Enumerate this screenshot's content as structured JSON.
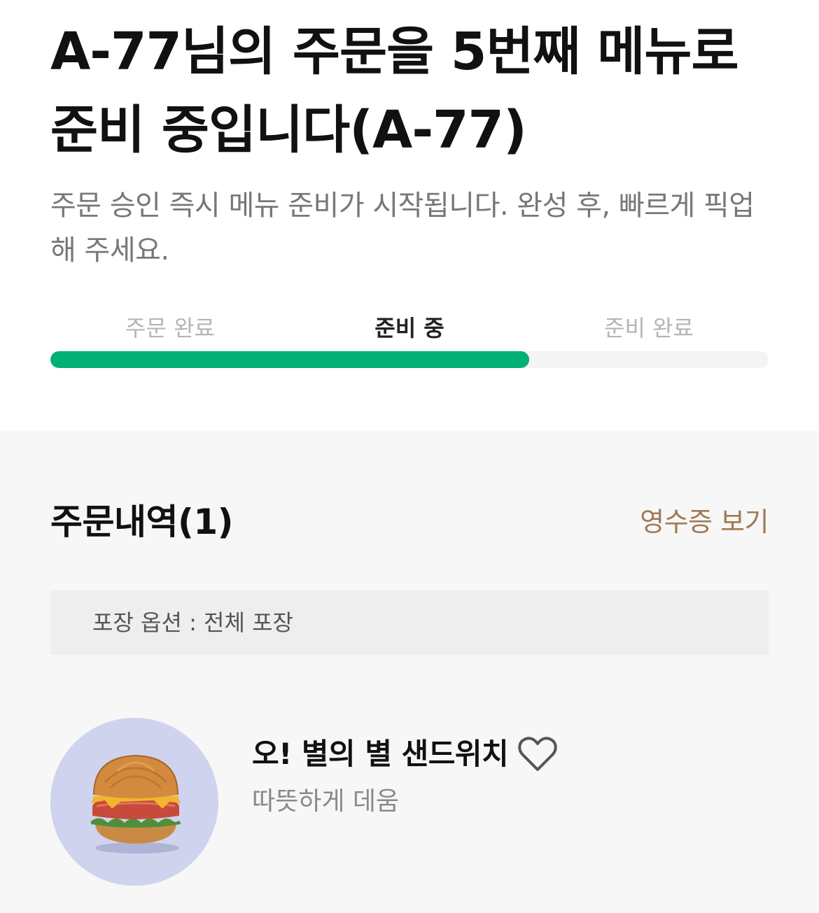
{
  "header": {
    "headline": "A-77님의 주문을 5번째 메뉴로 준비 중입니다(A-77)",
    "subtitle": "주문 승인 즉시 메뉴 준비가 시작됩니다. 완성 후, 빠르게 픽업해 주세요."
  },
  "progress": {
    "steps": [
      "주문 완료",
      "준비 중",
      "준비 완료"
    ],
    "current_step_index": 1,
    "fill_fraction": 0.667,
    "color": "#00b074"
  },
  "order": {
    "title": "주문내역(1)",
    "receipt_link": "영수증 보기",
    "option_text": "포장 옵션 : 전체 포장",
    "items": [
      {
        "name": "오! 별의 별 샌드위치",
        "option": "따뜻하게 데움",
        "image_icon": "sandwich-image",
        "favorite_icon": "heart-outline-icon",
        "favorited": false
      }
    ]
  },
  "colors": {
    "accent_green": "#00b074",
    "link_brown": "#a07a54",
    "thumb_bg": "#cfd3ee"
  }
}
